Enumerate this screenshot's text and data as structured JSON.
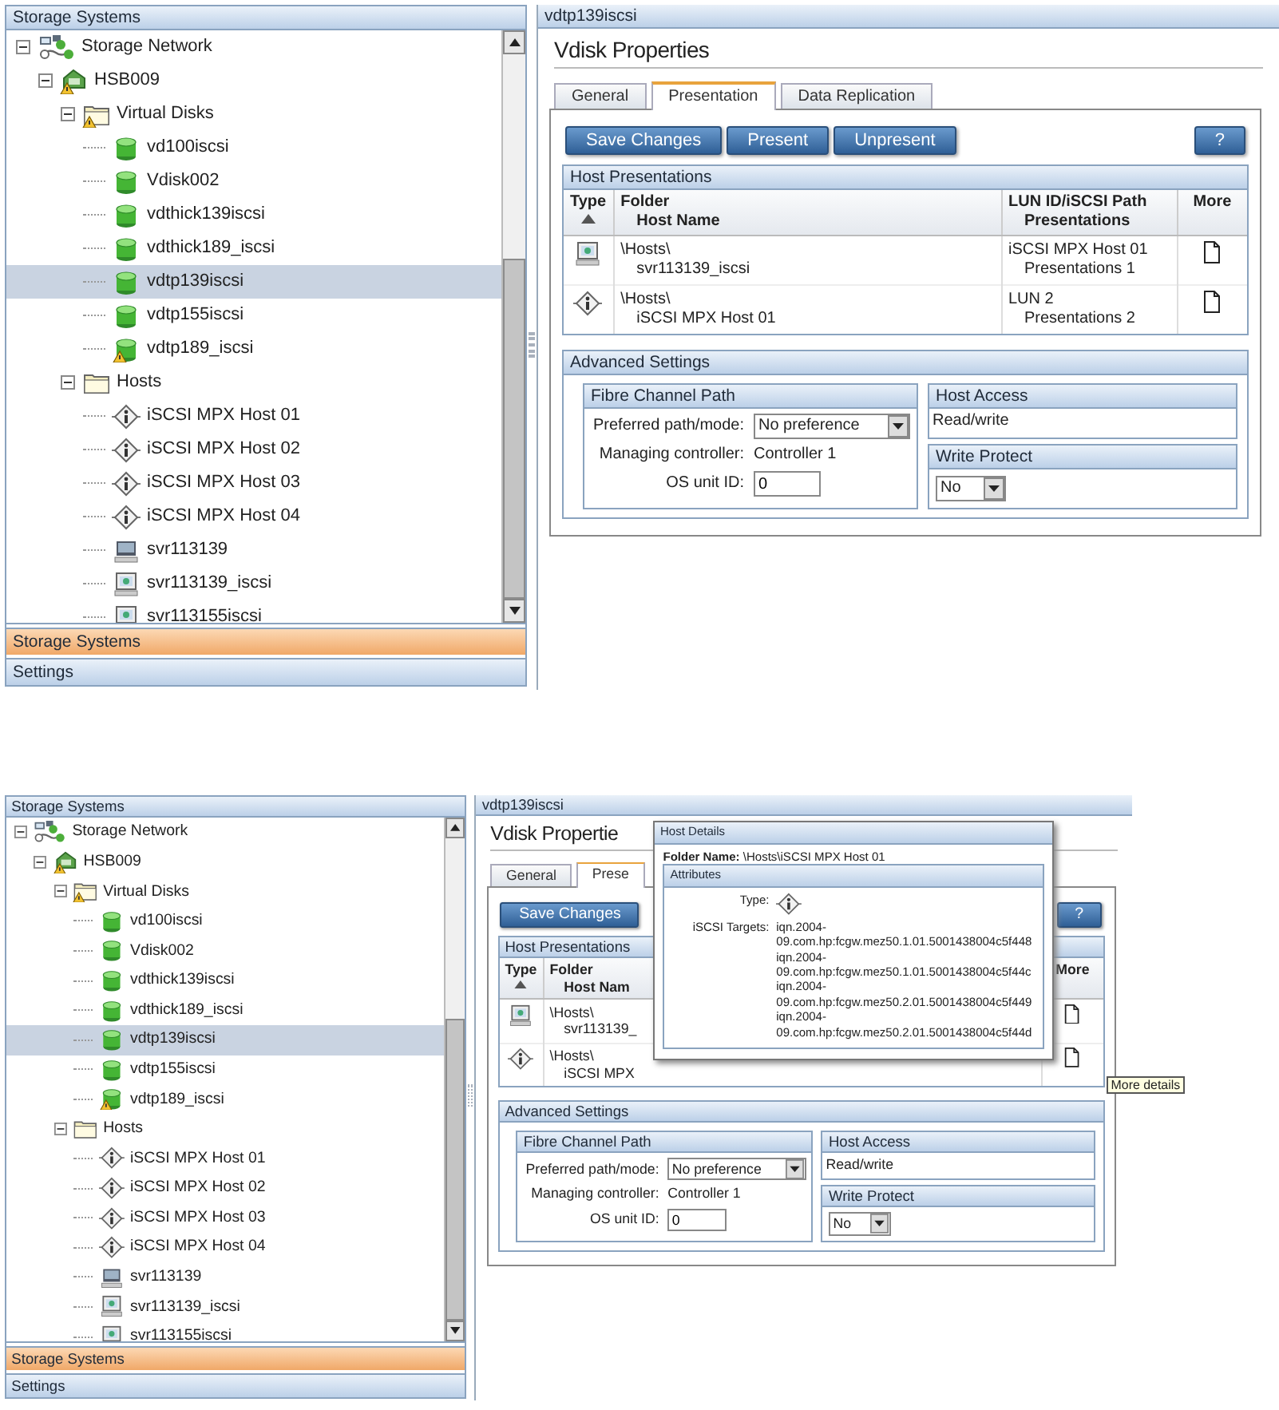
{
  "screens": [
    {
      "left_panel": {
        "title": "Storage Systems",
        "tree": [
          {
            "label": "Storage Network",
            "kind": "network",
            "warning": false,
            "expanded": true,
            "selected": false,
            "children": [
              {
                "label": "HSB009",
                "kind": "array",
                "warning": true,
                "expanded": true,
                "selected": false,
                "children": [
                  {
                    "label": "Virtual Disks",
                    "kind": "folder",
                    "warning": true,
                    "expanded": true,
                    "selected": false,
                    "children": [
                      {
                        "label": "vd100iscsi",
                        "kind": "vdisk",
                        "warning": false,
                        "selected": false
                      },
                      {
                        "label": "Vdisk002",
                        "kind": "vdisk",
                        "warning": false,
                        "selected": false
                      },
                      {
                        "label": "vdthick139iscsi",
                        "kind": "vdisk",
                        "warning": false,
                        "selected": false
                      },
                      {
                        "label": "vdthick189_iscsi",
                        "kind": "vdisk",
                        "warning": false,
                        "selected": false
                      },
                      {
                        "label": "vdtp139iscsi",
                        "kind": "vdisk",
                        "warning": false,
                        "selected": true
                      },
                      {
                        "label": "vdtp155iscsi",
                        "kind": "vdisk",
                        "warning": false,
                        "selected": false
                      },
                      {
                        "label": "vdtp189_iscsi",
                        "kind": "vdisk",
                        "warning": true,
                        "selected": false
                      }
                    ]
                  },
                  {
                    "label": "Hosts",
                    "kind": "folder",
                    "warning": false,
                    "expanded": true,
                    "selected": false,
                    "children": [
                      {
                        "label": "iSCSI MPX Host 01",
                        "kind": "iscsi",
                        "warning": false,
                        "selected": false
                      },
                      {
                        "label": "iSCSI MPX Host 02",
                        "kind": "iscsi",
                        "warning": false,
                        "selected": false
                      },
                      {
                        "label": "iSCSI MPX Host 03",
                        "kind": "iscsi",
                        "warning": false,
                        "selected": false
                      },
                      {
                        "label": "iSCSI MPX Host 04",
                        "kind": "iscsi",
                        "warning": false,
                        "selected": false
                      },
                      {
                        "label": "svr113139",
                        "kind": "server",
                        "warning": false,
                        "selected": false
                      },
                      {
                        "label": "svr113139_iscsi",
                        "kind": "iscsiserver",
                        "warning": false,
                        "selected": false
                      },
                      {
                        "label": "svr113155iscsi",
                        "kind": "iscsiserver",
                        "warning": false,
                        "selected": false
                      }
                    ]
                  }
                ]
              }
            ]
          }
        ],
        "nav": [
          {
            "label": "Storage Systems",
            "selected": true
          },
          {
            "label": "Settings",
            "selected": false
          }
        ]
      },
      "right_panel": {
        "title": "vdtp139iscsi",
        "heading": "Vdisk Properties",
        "tabs": [
          {
            "label": "General",
            "selected": false
          },
          {
            "label": "Presentation",
            "selected": true
          },
          {
            "label": "Data Replication",
            "selected": false
          }
        ],
        "buttons": [
          "Save Changes",
          "Present",
          "Unpresent"
        ],
        "help_button": "?",
        "host_presentations": {
          "title": "Host Presentations",
          "columns": [
            {
              "kind": "type",
              "top": "Type",
              "sorted": true
            },
            {
              "kind": "name",
              "top": "Folder",
              "bottom": "Host Name",
              "sorted": false
            },
            {
              "kind": "path",
              "top": "LUN ID/iSCSI Path",
              "bottom": "Presentations",
              "sorted": false
            },
            {
              "kind": "more",
              "top": "More",
              "sorted": false
            }
          ],
          "rows": [
            {
              "kind": "iscsiserver",
              "folder": "\\Hosts\\",
              "host": "svr113139_iscsi",
              "path": "iSCSI MPX Host 01",
              "presentations": "Presentations 1"
            },
            {
              "kind": "iscsi",
              "folder": "\\Hosts\\",
              "host": "iSCSI MPX Host 01",
              "path": "LUN  2",
              "presentations": "Presentations 2"
            }
          ]
        },
        "advanced_settings": {
          "title": "Advanced Settings",
          "fibre_channel_path": {
            "title": "Fibre Channel Path",
            "fields": [
              {
                "kind": "select",
                "label": "Preferred path/mode:",
                "value": "No preference"
              },
              {
                "kind": "text",
                "label": "Managing controller:",
                "value": "Controller 1"
              },
              {
                "kind": "input",
                "label": "OS unit ID:",
                "value": "0"
              }
            ]
          },
          "host_access": {
            "title": "Host Access",
            "value": "Read/write"
          },
          "write_protect": {
            "title": "Write Protect",
            "value": "No"
          }
        }
      }
    },
    {
      "left_panel": {
        "title": "Storage Systems",
        "tree": [
          {
            "label": "Storage Network",
            "kind": "network",
            "warning": false,
            "expanded": true,
            "selected": false,
            "children": [
              {
                "label": "HSB009",
                "kind": "array",
                "warning": true,
                "expanded": true,
                "selected": false,
                "children": [
                  {
                    "label": "Virtual Disks",
                    "kind": "folder",
                    "warning": true,
                    "expanded": true,
                    "selected": false,
                    "children": [
                      {
                        "label": "vd100iscsi",
                        "kind": "vdisk",
                        "warning": false,
                        "selected": false
                      },
                      {
                        "label": "Vdisk002",
                        "kind": "vdisk",
                        "warning": false,
                        "selected": false
                      },
                      {
                        "label": "vdthick139iscsi",
                        "kind": "vdisk",
                        "warning": false,
                        "selected": false
                      },
                      {
                        "label": "vdthick189_iscsi",
                        "kind": "vdisk",
                        "warning": false,
                        "selected": false
                      },
                      {
                        "label": "vdtp139iscsi",
                        "kind": "vdisk",
                        "warning": false,
                        "selected": true
                      },
                      {
                        "label": "vdtp155iscsi",
                        "kind": "vdisk",
                        "warning": false,
                        "selected": false
                      },
                      {
                        "label": "vdtp189_iscsi",
                        "kind": "vdisk",
                        "warning": true,
                        "selected": false
                      }
                    ]
                  },
                  {
                    "label": "Hosts",
                    "kind": "folder",
                    "warning": false,
                    "expanded": true,
                    "selected": false,
                    "children": [
                      {
                        "label": "iSCSI MPX Host 01",
                        "kind": "iscsi",
                        "warning": false,
                        "selected": false
                      },
                      {
                        "label": "iSCSI MPX Host 02",
                        "kind": "iscsi",
                        "warning": false,
                        "selected": false
                      },
                      {
                        "label": "iSCSI MPX Host 03",
                        "kind": "iscsi",
                        "warning": false,
                        "selected": false
                      },
                      {
                        "label": "iSCSI MPX Host 04",
                        "kind": "iscsi",
                        "warning": false,
                        "selected": false
                      },
                      {
                        "label": "svr113139",
                        "kind": "server",
                        "warning": false,
                        "selected": false
                      },
                      {
                        "label": "svr113139_iscsi",
                        "kind": "iscsiserver",
                        "warning": false,
                        "selected": false
                      },
                      {
                        "label": "svr113155iscsi",
                        "kind": "iscsiserver",
                        "warning": false,
                        "selected": false
                      }
                    ]
                  }
                ]
              }
            ]
          }
        ],
        "nav": [
          {
            "label": "Storage Systems",
            "selected": true
          },
          {
            "label": "Settings",
            "selected": false
          }
        ]
      },
      "right_panel": {
        "title": "vdtp139iscsi",
        "heading": "Vdisk Propertie",
        "tabs": [
          {
            "label": "General",
            "selected": false
          },
          {
            "label": "Prese",
            "selected": true
          }
        ],
        "buttons": [
          "Save Changes"
        ],
        "help_button": "?",
        "host_presentations": {
          "title": "Host Presentations",
          "columns": [
            {
              "kind": "type",
              "top": "Type",
              "sorted": true
            },
            {
              "kind": "name",
              "top": "Folder",
              "bottom": "Host Nam",
              "sorted": false
            },
            {
              "kind": "more",
              "top": "More",
              "sorted": false
            }
          ],
          "rows": [
            {
              "kind": "iscsiserver",
              "folder": "\\Hosts\\",
              "host": "svr113139_"
            },
            {
              "kind": "iscsi",
              "folder": "\\Hosts\\",
              "host": "iSCSI MPX"
            }
          ]
        },
        "advanced_settings": {
          "title": "Advanced Settings",
          "fibre_channel_path": {
            "title": "Fibre Channel Path",
            "fields": [
              {
                "kind": "select",
                "label": "Preferred path/mode:",
                "value": "No preference"
              },
              {
                "kind": "text",
                "label": "Managing controller:",
                "value": "Controller 1"
              },
              {
                "kind": "input",
                "label": "OS unit ID:",
                "value": "0"
              }
            ]
          },
          "host_access": {
            "title": "Host Access",
            "value": "Read/write"
          },
          "write_protect": {
            "title": "Write Protect",
            "value": "No"
          }
        },
        "popup": {
          "title": "Host Details",
          "folder_name": "**Folder Name:** \\Hosts\\iSCSI MPX Host 01",
          "attributes": {
            "title": "Attributes",
            "type_label": "Type:",
            "type": {
              "kind": "iscsi"
            },
            "targets_label": "iSCSI Targets:",
            "targets": [
              "iqn.2004-09.com.hp:fcgw.mez50.1.01.5001438004c5f448",
              "iqn.2004-09.com.hp:fcgw.mez50.1.01.5001438004c5f44c",
              "iqn.2004-09.com.hp:fcgw.mez50.2.01.5001438004c5f449",
              "iqn.2004-09.com.hp:fcgw.mez50.2.01.5001438004c5f44d"
            ]
          }
        },
        "tooltip": "More details"
      }
    }
  ]
}
